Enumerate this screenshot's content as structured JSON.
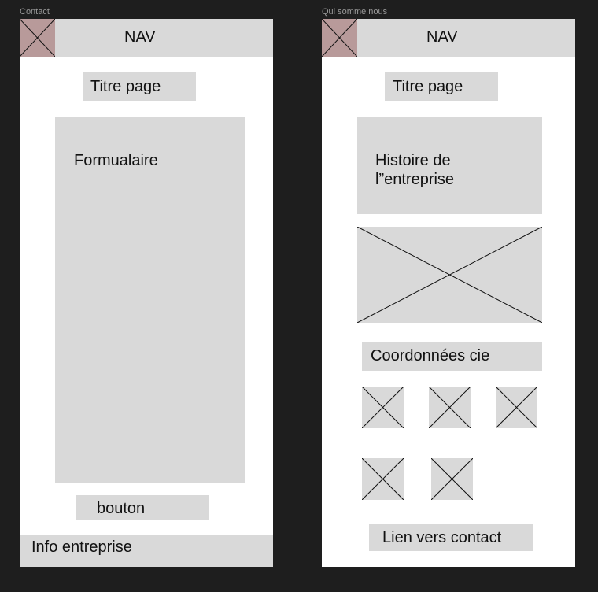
{
  "frames": [
    {
      "label": "Contact",
      "nav_label": "NAV",
      "title": "Titre page",
      "form_label": "Formualaire",
      "button_label": "bouton",
      "footer_label": "Info entreprise"
    },
    {
      "label": "Qui somme nous",
      "nav_label": "NAV",
      "title": "Titre page",
      "history_label": "Histoire de\nl”entreprise",
      "contact_info_label": "Coordonnées cie",
      "contact_link_label": "Lien vers contact"
    }
  ],
  "colors": {
    "canvas": "#1e1e1e",
    "frame": "#ffffff",
    "placeholder": "#d9d9d9",
    "logo": "#b89a9a"
  }
}
